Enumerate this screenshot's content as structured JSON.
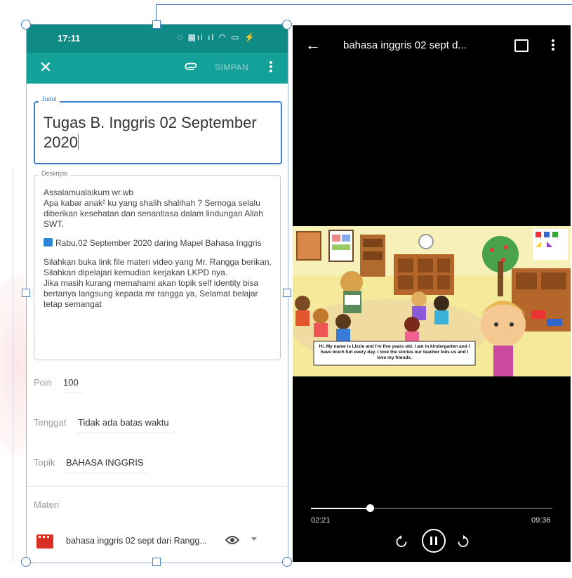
{
  "status_bar": {
    "time": "17:11",
    "icons": "◌ ▩ıl ıl ◠ ▭ ⚡"
  },
  "app_bar": {
    "save_label": "SIMPAN"
  },
  "form": {
    "title_label": "Judul",
    "title_value": "Tugas B. Inggris 02 September 2020",
    "desc_label": "Deskripsi",
    "desc_paragraphs": [
      "Assalamualaikum wr.wb\nApa kabar anak² ku yang shalih shalihah ? Semoga selalu diberikan kesehatan dan senantiasa dalam lindungan Allah SWT.",
      "Rabu,02 September 2020  daring Mapel Bahasa Inggris",
      "Silahkan buka link file materi video yang Mr. Rangga berikan, Silahkan dipelajari kemudian kerjakan LKPD nya.\nJika masih kurang memahami akan topik self identity bisa bertanya langsung kepada mr rangga ya, Selamat belajar tetap semangat"
    ],
    "poin_label": "Poin",
    "poin_value": "100",
    "tenggat_label": "Tenggat",
    "tenggat_value": "Tidak ada batas waktu",
    "topik_label": "Topik",
    "topik_value": "BAHASA INGGRIS",
    "materi_label": "Materi",
    "materi_item": "bahasa inggris 02 sept dari Rangg..."
  },
  "player": {
    "title": "bahasa inggris 02 sept d...",
    "caption": "Hi. My name is Lizzie and I'm five years old. I am in kindergarten and I have much fun every day. I love the stories our teacher tells us and I love my friends.",
    "current_time": "02:21",
    "duration": "09:36",
    "progress": 0.245
  },
  "colors": {
    "status_bar": "#0f8a85",
    "app_bar": "#13a19a",
    "focus": "#3b7fd6",
    "player_bg": "#000000"
  },
  "icons": [
    "close-icon",
    "attach-icon",
    "more-vert-icon",
    "calendar-icon",
    "film-icon",
    "eye-icon",
    "dropdown-icon",
    "back-arrow-icon",
    "subtitles-icon",
    "rewind-10-icon",
    "pause-icon",
    "forward-10-icon"
  ]
}
